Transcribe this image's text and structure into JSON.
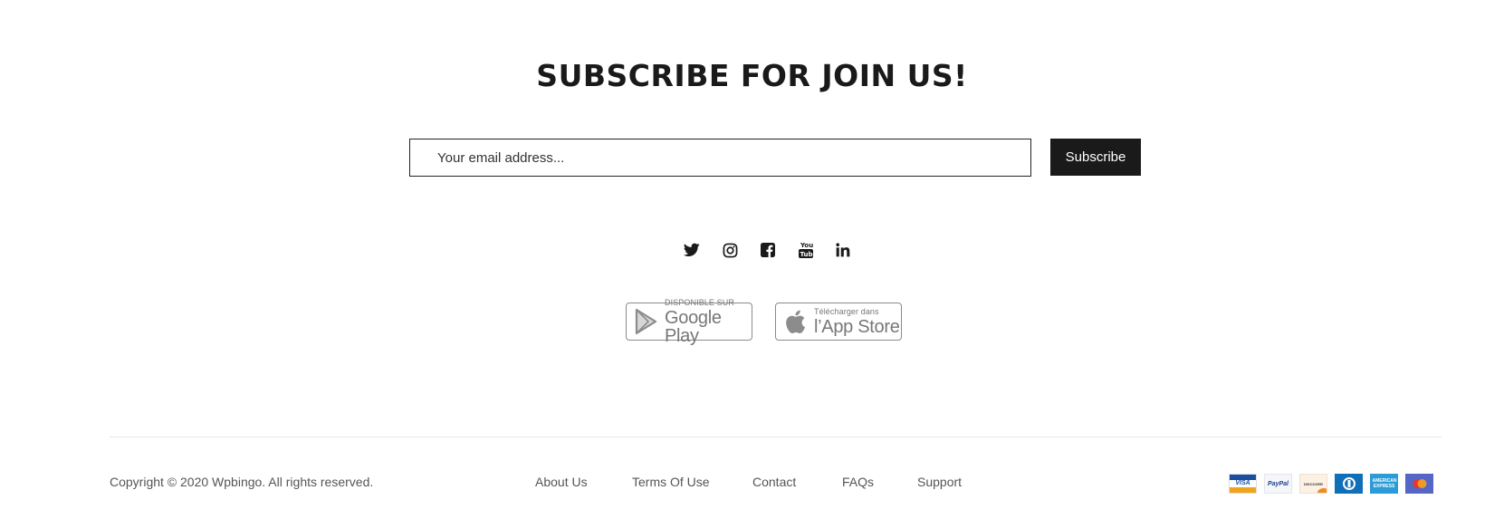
{
  "newsletter": {
    "title": "SUBSCRIBE FOR JOIN US!",
    "email_placeholder": "Your email address...",
    "subscribe_label": "Subscribe"
  },
  "social": [
    "twitter-icon",
    "instagram-icon",
    "facebook-icon",
    "youtube-icon",
    "linkedin-icon"
  ],
  "app_badges": {
    "google": {
      "small": "DISPONIBLE SUR",
      "big": "Google Play"
    },
    "apple": {
      "small": "Télécharger dans",
      "big": "l’App Store"
    }
  },
  "footer": {
    "copyright": "Copyright © 2020 Wpbingo. All rights reserved.",
    "links": [
      "About Us",
      "Terms Of Use",
      "Contact",
      "FAQs",
      "Support"
    ]
  },
  "payments": {
    "visa": "VISA",
    "paypal": "PayPal",
    "discover": "DISCOVER",
    "amex": "AMERICAN EXPRESS",
    "icons": [
      "visa-card-icon",
      "paypal-card-icon",
      "discover-card-icon",
      "diners-club-card-icon",
      "amex-card-icon",
      "mastercard-card-icon"
    ]
  },
  "colors": {
    "text_dark": "#1a1a1a",
    "button_bg": "#1a1a1a",
    "link_gray": "#555555",
    "badge_gray": "#777777"
  }
}
